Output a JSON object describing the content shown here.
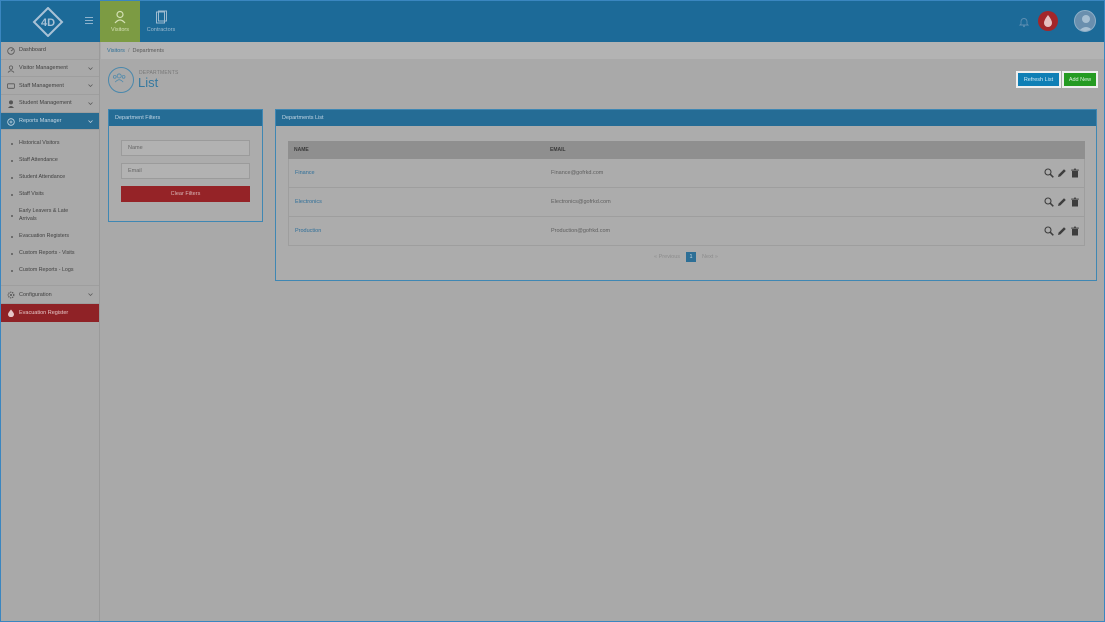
{
  "topbar": {
    "logo_text": "4D",
    "tabs": [
      {
        "label": "Visitors",
        "icon": "user-icon"
      },
      {
        "label": "Contractors",
        "icon": "clipboard-icon"
      }
    ]
  },
  "sidebar": {
    "items": [
      {
        "label": "Dashboard",
        "icon": "dashboard-icon"
      },
      {
        "label": "Visitor Management",
        "icon": "user-icon"
      },
      {
        "label": "Staff Management",
        "icon": "id-card-icon"
      },
      {
        "label": "Student Management",
        "icon": "student-icon"
      },
      {
        "label": "Reports Manager",
        "icon": "report-icon"
      }
    ],
    "reports_sub": [
      "Historical Visitors",
      "Staff Attendance",
      "Student Attendance",
      "Staff Visits",
      "Early Leavers & Late Arrivals",
      "Evacuation Registers",
      "Custom Reports - Visits",
      "Custom Reports - Logs"
    ],
    "configuration": "Configuration",
    "evacuation": "Evacuation Register"
  },
  "breadcrumb": {
    "root": "Visitors",
    "separator": "/",
    "current": "Departments"
  },
  "page": {
    "subtitle": "DEPARTMENTS",
    "title": "List",
    "refresh_label": "Refresh List",
    "add_label": "Add New"
  },
  "filters": {
    "title": "Department Filters",
    "name_placeholder": "Name",
    "email_placeholder": "Email",
    "clear_label": "Clear Filters"
  },
  "list": {
    "title": "Departments List",
    "columns": [
      "NAME",
      "EMAIL"
    ],
    "rows": [
      {
        "name": "Finance",
        "email": "Finance@gofrkd.com"
      },
      {
        "name": "Electronics",
        "email": "Electronics@gofrkd.com"
      },
      {
        "name": "Production",
        "email": "Production@gofrkd.com"
      }
    ],
    "pagination": {
      "previous": "« Previous",
      "page": "1",
      "next": "Next »"
    }
  },
  "colors": {
    "topbar": "#1c6a98",
    "accent": "#256c95",
    "danger": "#952327",
    "success": "#259b22",
    "primary": "#0f7fb5"
  }
}
